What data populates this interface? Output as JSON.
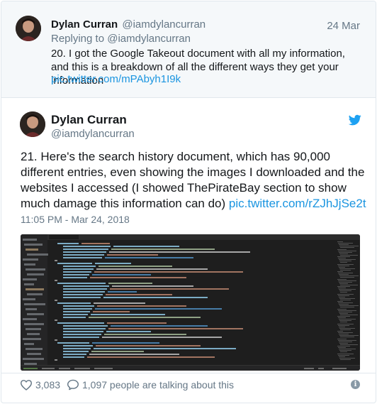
{
  "parent_tweet": {
    "name": "Dylan Curran",
    "handle": "@iamdylancurran",
    "date": "24 Mar",
    "replying_prefix": "Replying to",
    "replying_to": "@iamdylancurran",
    "text": "20. I got the Google Takeout document with all my information, and this is a breakdown of all the different ways they get your information",
    "link": "pic.twitter.com/mPAbyh1I9k"
  },
  "main_tweet": {
    "name": "Dylan Curran",
    "handle": "@iamdylancurran",
    "text": "21. Here's the search history document, which has 90,000 different entries, even showing the images I downloaded and the websites I accessed (I showed ThePirateBay section to show much damage this information can do)",
    "link": "pic.twitter.com/rZJhJjSe2t",
    "timestamp": "11:05 PM - Mar 24, 2018"
  },
  "footer": {
    "like_count": "3,083",
    "talk_text": "1,097 people are talking about this"
  },
  "icons": {
    "bird": "twitter-bird-icon",
    "heart": "heart-icon",
    "comment": "comment-bubble-icon",
    "info": "info-icon"
  },
  "colors": {
    "link": "#1b95e0",
    "muted": "#657786",
    "editor_bg": "#1e1e1e",
    "bird": "#1da1f2"
  }
}
